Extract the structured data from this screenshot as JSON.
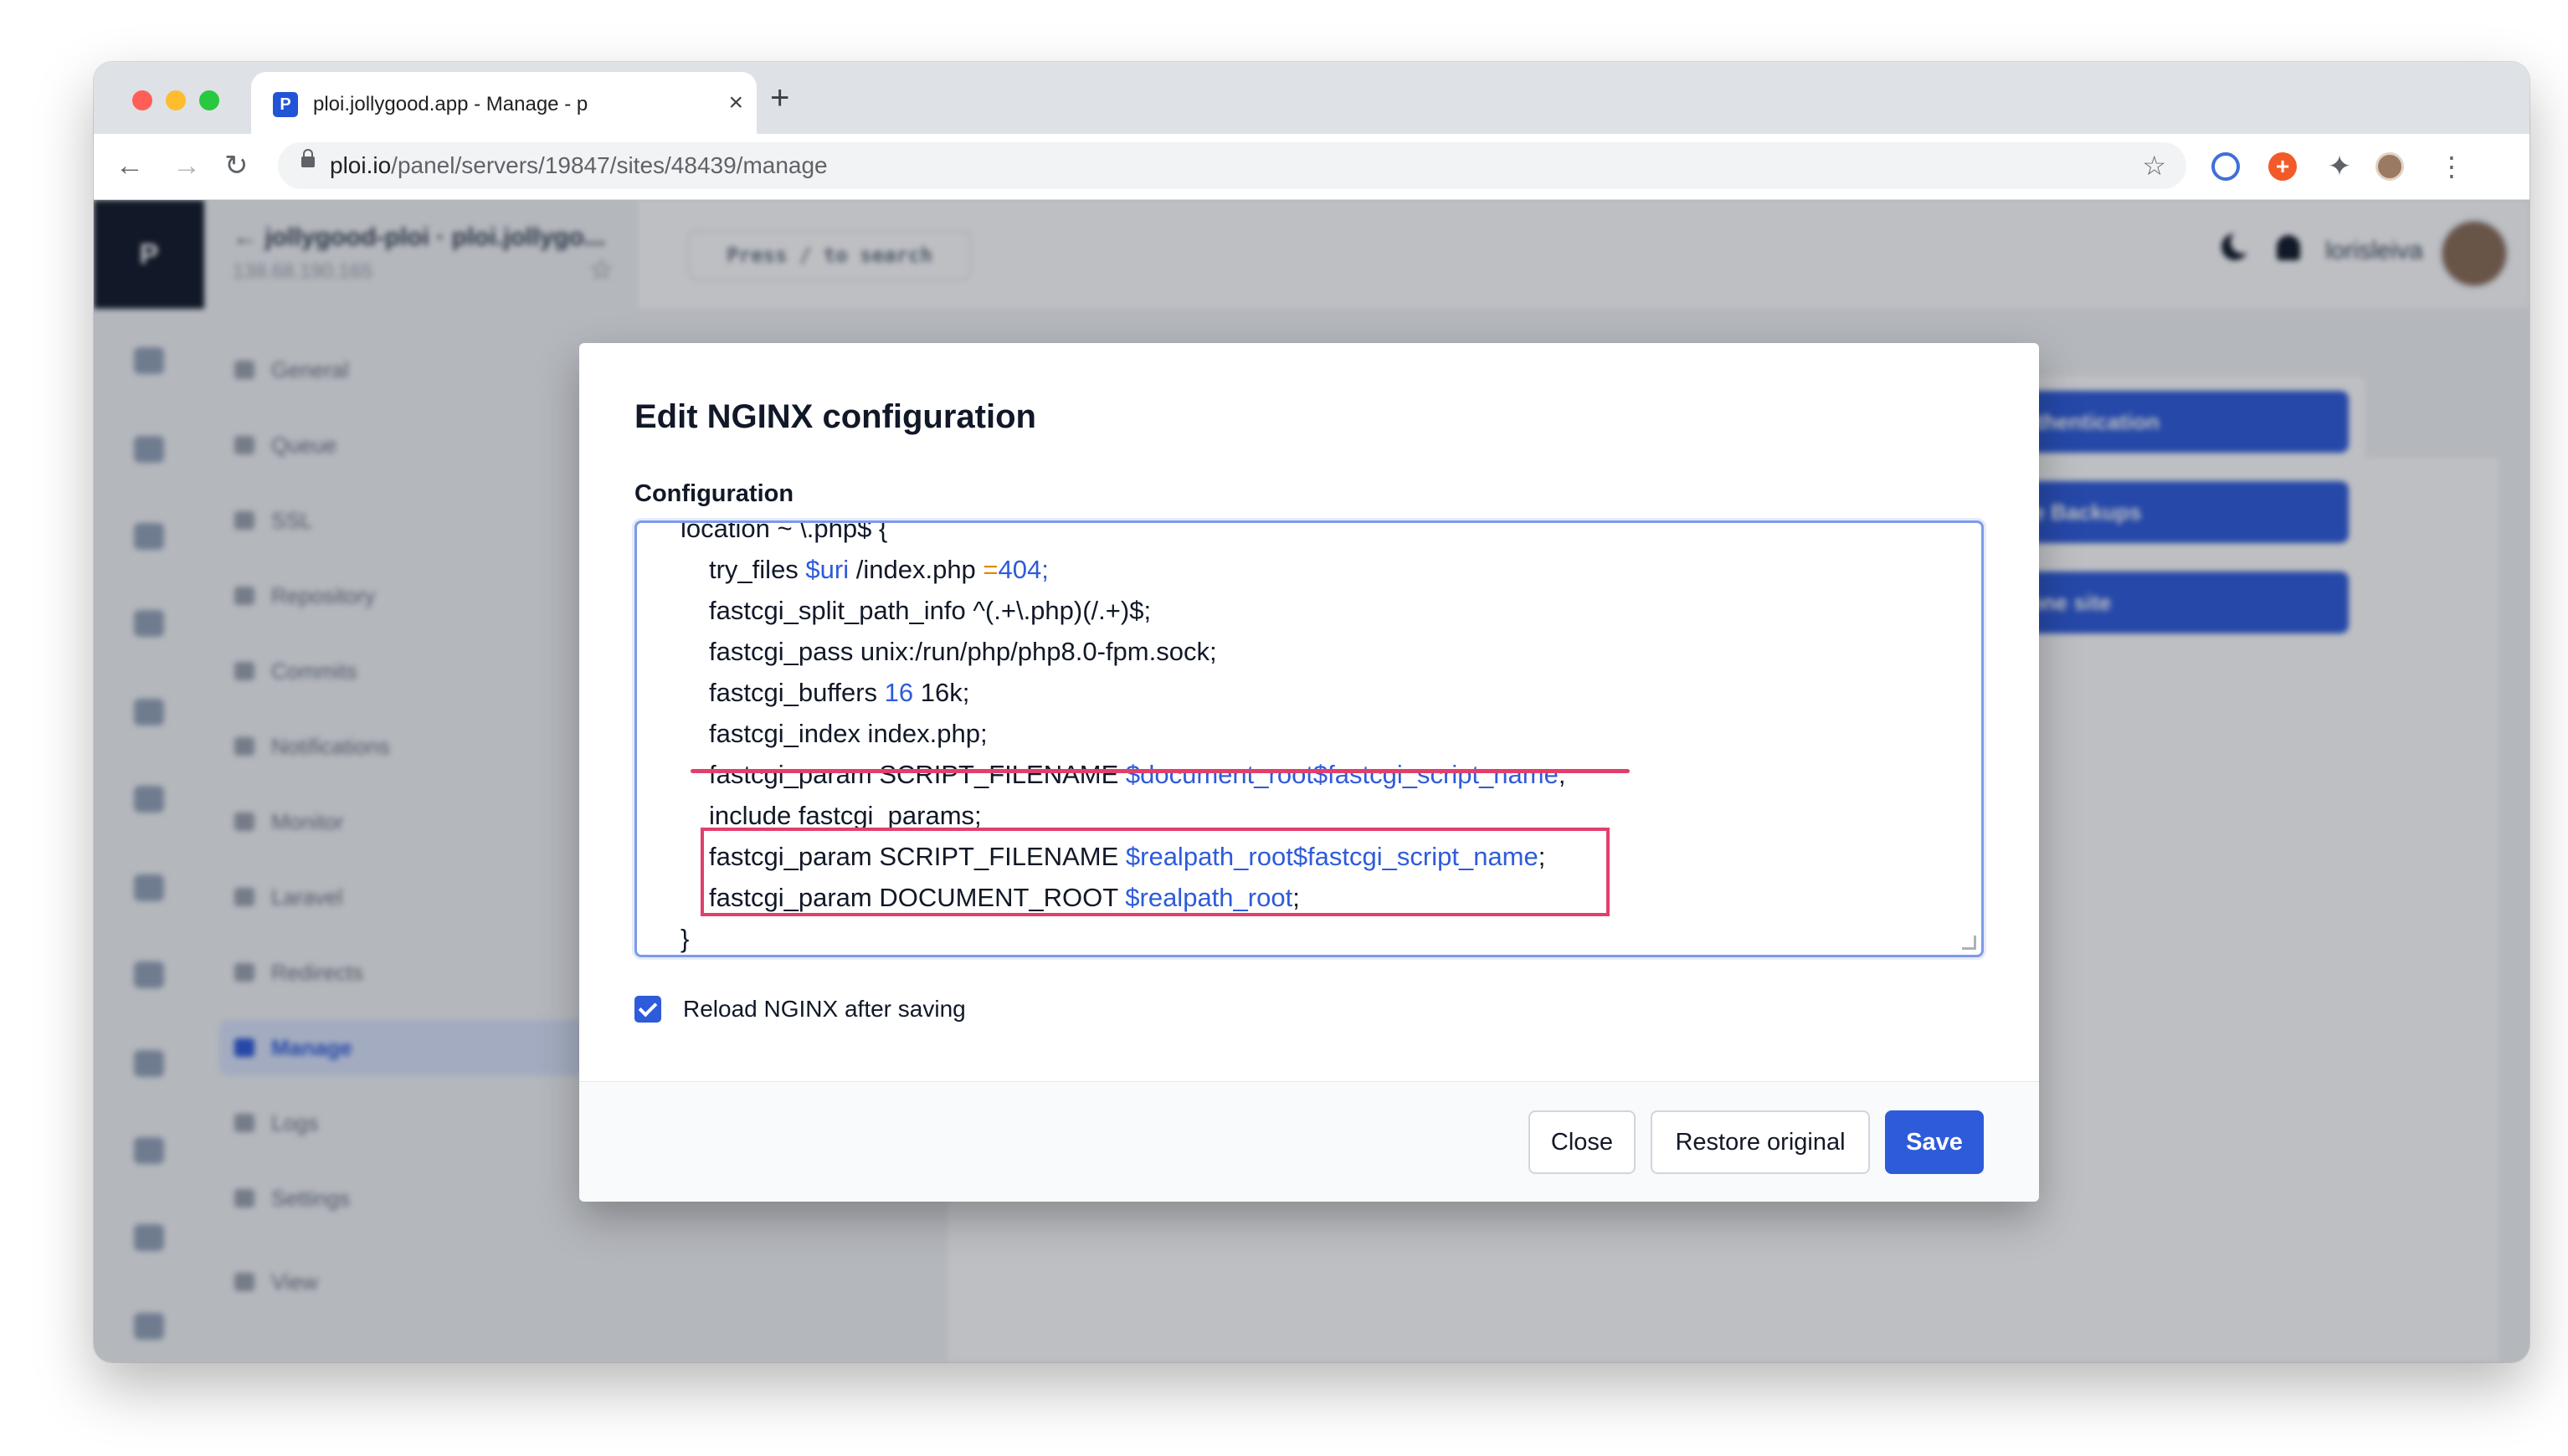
{
  "browser": {
    "tab_title": "ploi.jollygood.app - Manage - p",
    "tab_favicon_letter": "P",
    "url_host": "ploi.io",
    "url_path": "/panel/servers/19847/sites/48439/manage"
  },
  "app": {
    "logo_letter": "P",
    "site_title": "← jollygood-ploi · ploi.jollygo...",
    "site_ip": "138.68.190.165",
    "search_hint": "Press / to search",
    "username": "lorisleiva",
    "sidebar_items": [
      {
        "label": "General"
      },
      {
        "label": "Queue"
      },
      {
        "label": "SSL"
      },
      {
        "label": "Repository"
      },
      {
        "label": "Commits"
      },
      {
        "label": "Notifications"
      },
      {
        "label": "Monitor"
      },
      {
        "label": "Laravel"
      },
      {
        "label": "Redirects"
      },
      {
        "label": "Manage"
      },
      {
        "label": "Logs"
      },
      {
        "label": "Settings"
      },
      {
        "label": "View"
      }
    ],
    "actions": [
      {
        "label": "Authentication"
      },
      {
        "label": "File Backups"
      },
      {
        "label": "Clone site"
      }
    ]
  },
  "modal": {
    "title": "Edit NGINX configuration",
    "config_label": "Configuration",
    "code": {
      "l0": "location ~ \\.php$ {",
      "l1_kw": "try_files ",
      "l1_var": "$uri",
      "l1_mid": " /index.php ",
      "l1_op": "=",
      "l1_num": "404",
      "l1_end": ";",
      "l2": "fastcgi_split_path_info ^(.+\\.php)(/.+)$;",
      "l3": "fastcgi_pass unix:/run/php/php8.0-fpm.sock;",
      "l4_kw": "fastcgi_buffers ",
      "l4_num": "16",
      "l4_end": " 16k;",
      "l5": "fastcgi_index index.php;",
      "l6_kw": "fastcgi_param SCRIPT_FILENAME ",
      "l6_var": "$document_root$fastcgi_script_name",
      "l6_end": ";",
      "l7": "include fastcgi_params;",
      "l8_kw": "fastcgi_param SCRIPT_FILENAME ",
      "l8_var": "$realpath_root$fastcgi_script_name",
      "l8_end": ";",
      "l9_kw": "fastcgi_param DOCUMENT_ROOT ",
      "l9_var": "$realpath_root",
      "l9_end": ";",
      "l10": "}"
    },
    "reload_checkbox_label": "Reload NGINX after saving",
    "reload_checked": true,
    "buttons": {
      "close": "Close",
      "restore": "Restore original",
      "save": "Save"
    }
  },
  "colors": {
    "primary": "#2e5bda",
    "annotation": "#e23f6d"
  }
}
